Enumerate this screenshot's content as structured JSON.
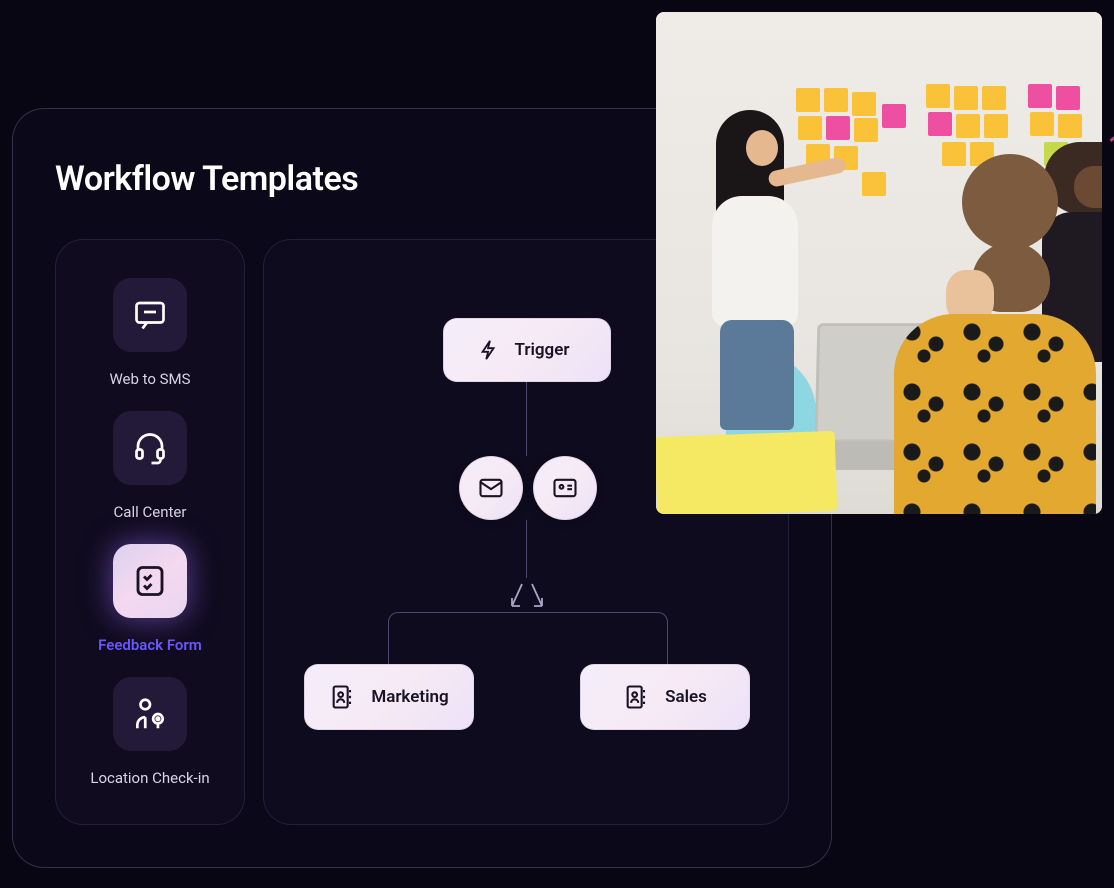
{
  "panel": {
    "title": "Workflow Templates"
  },
  "templates": [
    {
      "id": "web-to-sms",
      "label": "Web to SMS",
      "icon": "chat-icon",
      "active": false
    },
    {
      "id": "call-center",
      "label": "Call Center",
      "icon": "headset-icon",
      "active": false
    },
    {
      "id": "feedback-form",
      "label": "Feedback Form",
      "icon": "checklist-icon",
      "active": true
    },
    {
      "id": "location-checkin",
      "label": "Location Check-in",
      "icon": "person-pin-icon",
      "active": false
    }
  ],
  "flow": {
    "trigger": {
      "label": "Trigger",
      "icon": "lightning-icon"
    },
    "middleNodes": [
      {
        "id": "email",
        "icon": "mail-icon"
      },
      {
        "id": "card",
        "icon": "id-card-icon"
      }
    ],
    "branches": [
      {
        "id": "marketing",
        "label": "Marketing",
        "icon": "contact-book-icon"
      },
      {
        "id": "sales",
        "label": "Sales",
        "icon": "contact-book-icon"
      }
    ]
  },
  "colors": {
    "background": "#080613",
    "accent": "#6a55ff",
    "nodeFill": "#f2e8f8",
    "border": "rgba(160,150,200,0.2)"
  }
}
